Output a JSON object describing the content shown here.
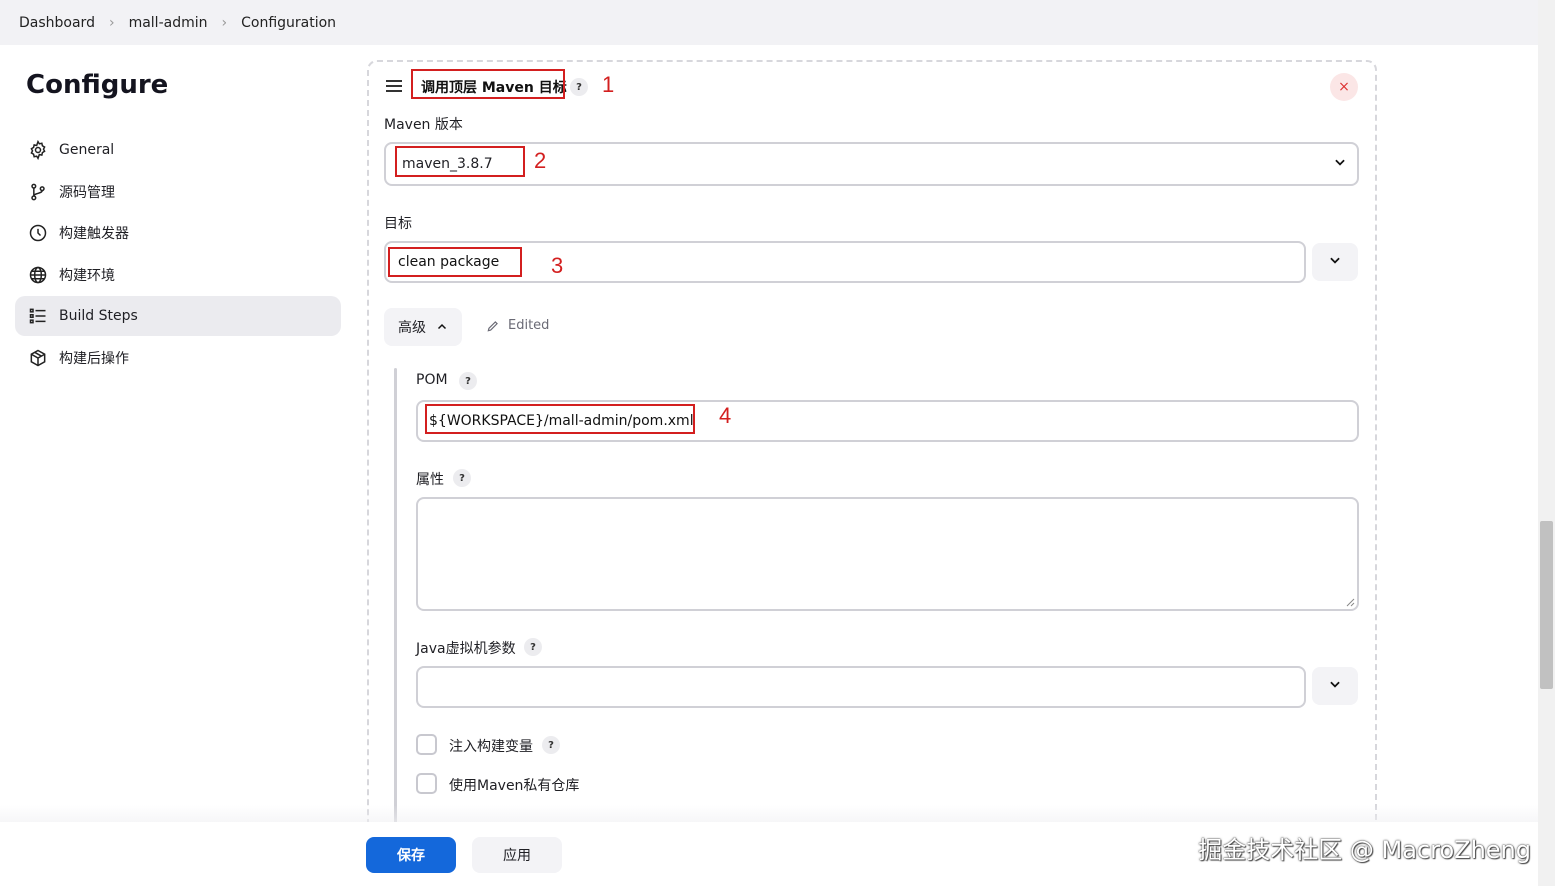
{
  "breadcrumb": {
    "items": [
      "Dashboard",
      "mall-admin",
      "Configuration"
    ],
    "separator": ">"
  },
  "page": {
    "title": "Configure"
  },
  "sidebar": {
    "items": [
      {
        "label": "General",
        "icon": "gear-icon",
        "active": false
      },
      {
        "label": "源码管理",
        "icon": "git-branch-icon",
        "active": false
      },
      {
        "label": "构建触发器",
        "icon": "clock-icon",
        "active": false
      },
      {
        "label": "构建环境",
        "icon": "globe-icon",
        "active": false
      },
      {
        "label": "Build Steps",
        "icon": "list-icon",
        "active": true
      },
      {
        "label": "构建后操作",
        "icon": "package-icon",
        "active": false
      }
    ]
  },
  "section": {
    "title": "调用顶层 Maven 目标",
    "help": "?",
    "close": "×",
    "maven_version_label": "Maven 版本",
    "maven_version_value": "maven_3.8.7",
    "goals_label": "目标",
    "goals_value": "clean package",
    "advanced_label": "高级",
    "edited_label": "Edited",
    "pom_label": "POM",
    "pom_value": "${WORKSPACE}/mall-admin/pom.xml",
    "properties_label": "属性",
    "properties_value": "",
    "jvm_label": "Java虚拟机参数",
    "jvm_value": "",
    "inject_vars_label": "注入构建变量",
    "private_repo_label": "使用Maven私有仓库"
  },
  "annotations": [
    "1",
    "2",
    "3",
    "4"
  ],
  "footer": {
    "save_label": "保存",
    "apply_label": "应用"
  },
  "watermark": "掘金技术社区 @ MacroZheng",
  "colors": {
    "accent": "#1468db",
    "annotation": "#d31f1f",
    "close": "#d33333",
    "active_nav_bg": "#ebebef"
  }
}
